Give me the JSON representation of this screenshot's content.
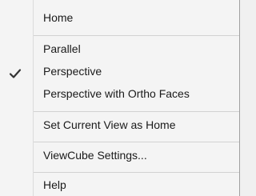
{
  "menu": {
    "items": [
      {
        "label": "Home",
        "checked": false
      },
      {
        "label": "Parallel",
        "checked": false
      },
      {
        "label": "Perspective",
        "checked": true
      },
      {
        "label": "Perspective with Ortho Faces",
        "checked": false
      },
      {
        "label": "Set Current View as Home",
        "checked": false
      },
      {
        "label": "ViewCube Settings...",
        "checked": false
      },
      {
        "label": "Help",
        "checked": false
      }
    ],
    "check_icon": "checkmark-icon",
    "colors": {
      "background": "#f4f4f4",
      "separator": "#d2d2d2",
      "text": "#1a1a1a",
      "check": "#333333"
    }
  }
}
